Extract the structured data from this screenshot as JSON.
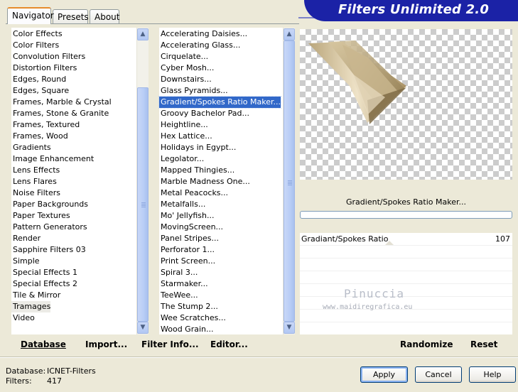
{
  "app": {
    "title": "Filters Unlimited 2.0"
  },
  "tabs": [
    {
      "label": "Navigator"
    },
    {
      "label": "Presets"
    },
    {
      "label": "About"
    }
  ],
  "categories": {
    "items": [
      "Color Effects",
      "Color Filters",
      "Convolution Filters",
      "Distortion Filters",
      "Edges, Round",
      "Edges, Square",
      "Frames, Marble & Crystal",
      "Frames, Stone & Granite",
      "Frames, Textured",
      "Frames, Wood",
      "Gradients",
      "Image Enhancement",
      "Lens Effects",
      "Lens Flares",
      "Noise Filters",
      "Paper Backgrounds",
      "Paper Textures",
      "Pattern Generators",
      "Render",
      "Sapphire Filters 03",
      "Simple",
      "Special Effects 1",
      "Special Effects 2",
      "Tile & Mirror",
      "Tramages",
      "Video"
    ],
    "selected": "Tramages"
  },
  "filters": {
    "items": [
      "Accelerating Daisies...",
      "Accelerating Glass...",
      "Cirquelate...",
      "Cyber Mosh...",
      "Downstairs...",
      "Glass Pyramids...",
      "Gradient/Spokes Ratio Maker...",
      "Groovy Bachelor Pad...",
      "Heightline...",
      "Hex Lattice...",
      "Holidays in Egypt...",
      "Legolator...",
      "Mapped Thingies...",
      "Marble Madness One...",
      "Metal Peacocks...",
      "Metalfalls...",
      "Mo' Jellyfish...",
      "MovingScreen...",
      "Panel Stripes...",
      "Perforator 1...",
      "Print Screen...",
      "Spiral 3...",
      "Starmaker...",
      "TeeWee...",
      "The Stump 2...",
      "Wee Scratches...",
      "Wood Grain..."
    ],
    "selected": "Gradient/Spokes Ratio Maker..."
  },
  "preview": {
    "caption": "Gradient/Spokes Ratio Maker...",
    "progress": 0
  },
  "params": [
    {
      "label": "Gradiant/Spokes Ratio",
      "value": "107"
    }
  ],
  "watermark": {
    "name": "Pinuccia",
    "url": "www.maidiregrafica.eu"
  },
  "toolbar": {
    "database": "Database",
    "import": "Import...",
    "filter_info": "Filter Info...",
    "editor": "Editor...",
    "randomize": "Randomize",
    "reset": "Reset"
  },
  "status": {
    "database_label": "Database:",
    "database_value": "ICNET-Filters",
    "filters_label": "Filters:",
    "filters_value": "417"
  },
  "buttons": {
    "apply": "Apply",
    "cancel": "Cancel",
    "help": "Help"
  },
  "colors": {
    "banner": "#1b22a6",
    "selection": "#3168c9",
    "dialog_bg": "#ece9d8"
  }
}
